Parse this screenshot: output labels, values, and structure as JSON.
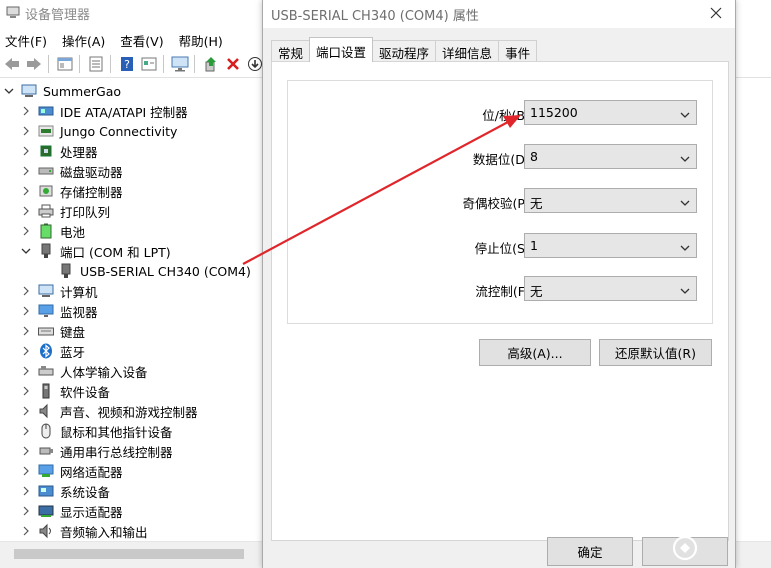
{
  "devmgr": {
    "title": "设备管理器",
    "menu": [
      "文件(F)",
      "操作(A)",
      "查看(V)",
      "帮助(H)"
    ],
    "toolbar": [
      "back-icon",
      "forward-icon",
      "properties-icon",
      "tree-view-icon",
      "help-icon",
      "details-icon",
      "monitor-icon",
      "update-driver-icon",
      "uninstall-icon",
      "scan-icon"
    ],
    "root": "SummerGao",
    "categories": [
      {
        "label": "IDE ATA/ATAPI 控制器",
        "icon": "ide-controller-icon",
        "expanded": false
      },
      {
        "label": "Jungo Connectivity",
        "icon": "jungo-icon",
        "expanded": false
      },
      {
        "label": "处理器",
        "icon": "processor-icon",
        "expanded": false
      },
      {
        "label": "磁盘驱动器",
        "icon": "disk-drive-icon",
        "expanded": false
      },
      {
        "label": "存储控制器",
        "icon": "storage-controller-icon",
        "expanded": false
      },
      {
        "label": "打印队列",
        "icon": "printer-icon",
        "expanded": false
      },
      {
        "label": "电池",
        "icon": "battery-icon",
        "expanded": false
      },
      {
        "label": "端口 (COM 和 LPT)",
        "icon": "port-icon",
        "expanded": true
      },
      {
        "label": "USB-SERIAL CH340 (COM4)",
        "icon": "port-icon",
        "child": true
      },
      {
        "label": "计算机",
        "icon": "computer-icon",
        "expanded": false
      },
      {
        "label": "监视器",
        "icon": "monitor-icon",
        "expanded": false
      },
      {
        "label": "键盘",
        "icon": "keyboard-icon",
        "expanded": false
      },
      {
        "label": "蓝牙",
        "icon": "bluetooth-icon",
        "expanded": false
      },
      {
        "label": "人体学输入设备",
        "icon": "hid-icon",
        "expanded": false
      },
      {
        "label": "软件设备",
        "icon": "software-device-icon",
        "expanded": false
      },
      {
        "label": "声音、视频和游戏控制器",
        "icon": "sound-icon",
        "expanded": false
      },
      {
        "label": "鼠标和其他指针设备",
        "icon": "mouse-icon",
        "expanded": false
      },
      {
        "label": "通用串行总线控制器",
        "icon": "usb-icon",
        "expanded": false
      },
      {
        "label": "网络适配器",
        "icon": "network-icon",
        "expanded": false
      },
      {
        "label": "系统设备",
        "icon": "system-device-icon",
        "expanded": false
      },
      {
        "label": "显示适配器",
        "icon": "display-adapter-icon",
        "expanded": false
      },
      {
        "label": "音频输入和输出",
        "icon": "audio-io-icon",
        "expanded": false
      }
    ]
  },
  "dialog": {
    "title": "USB-SERIAL CH340 (COM4) 属性",
    "tabs": [
      "常规",
      "端口设置",
      "驱动程序",
      "详细信息",
      "事件"
    ],
    "active_tab": "端口设置",
    "fields": [
      {
        "label": "位/秒(B):",
        "value": "115200"
      },
      {
        "label": "数据位(D):",
        "value": "8"
      },
      {
        "label": "奇偶校验(P):",
        "value": "无"
      },
      {
        "label": "停止位(S):",
        "value": "1"
      },
      {
        "label": "流控制(F):",
        "value": "无"
      }
    ],
    "advanced_button": "高级(A)...",
    "restore_button": "还原默认值(R)",
    "ok_button": "确定",
    "cancel_button": ""
  },
  "colors": {
    "annotation_arrow": "#e0262b",
    "accent_blue": "#1e6fc9"
  }
}
